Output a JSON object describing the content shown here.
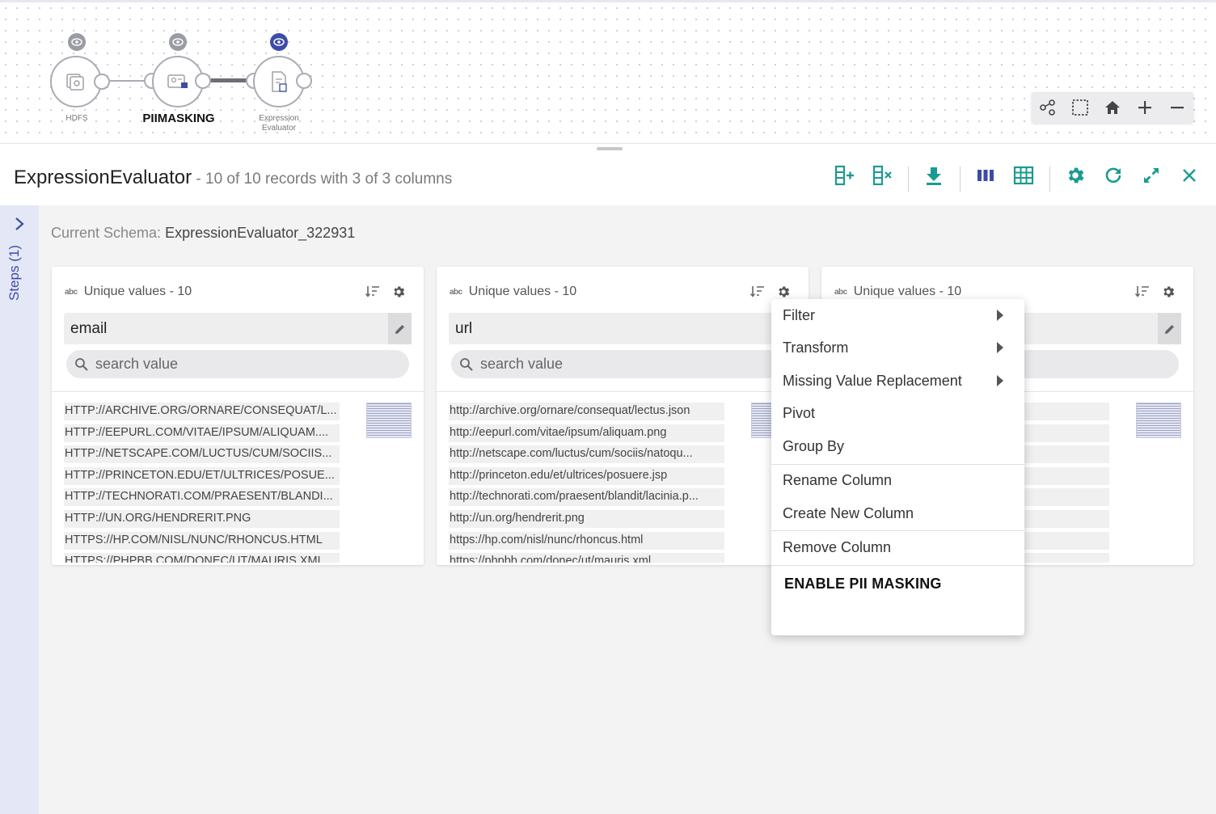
{
  "pipeline": {
    "nodes": [
      {
        "label": "HDFS"
      },
      {
        "label": "PIIMASKING"
      },
      {
        "label": "Expression Evaluator"
      }
    ],
    "tools": [
      "graph-icon",
      "select-icon",
      "home-icon",
      "zoom-in-icon",
      "zoom-out-icon"
    ]
  },
  "header": {
    "title": "ExpressionEvaluator",
    "subtitle": " - 10 of 10 records with 3 of 3 columns",
    "toolbar": [
      "add-column-icon",
      "remove-column-icon",
      "download-icon",
      "column-view-icon",
      "table-view-icon",
      "settings-icon",
      "refresh-icon",
      "expand-icon",
      "close-icon"
    ]
  },
  "steps": {
    "label": "Steps (1)"
  },
  "schema": {
    "label": "Current Schema: ",
    "name": "ExpressionEvaluator_322931"
  },
  "columns": [
    {
      "unique_label": "Unique values - 10",
      "name": "email",
      "search_placeholder": "search value",
      "values": [
        "HTTP://ARCHIVE.ORG/ORNARE/CONSEQUAT/L...",
        "HTTP://EEPURL.COM/VITAE/IPSUM/ALIQUAM....",
        "HTTP://NETSCAPE.COM/LUCTUS/CUM/SOCIIS...",
        "HTTP://PRINCETON.EDU/ET/ULTRICES/POSUE...",
        "HTTP://TECHNORATI.COM/PRAESENT/BLANDI...",
        "HTTP://UN.ORG/HENDRERIT.PNG",
        "HTTPS://HP.COM/NISL/NUNC/RHONCUS.HTML",
        "HTTPS://PHPBB.COM/DONEC/UT/MAURIS.XML"
      ]
    },
    {
      "unique_label": "Unique values - 10",
      "name": "url",
      "search_placeholder": "search value",
      "values": [
        "http://archive.org/ornare/consequat/lectus.json",
        "http://eepurl.com/vitae/ipsum/aliquam.png",
        "http://netscape.com/luctus/cum/sociis/natoqu...",
        "http://princeton.edu/et/ultrices/posuere.jsp",
        "http://technorati.com/praesent/blandit/lacinia.p...",
        "http://un.org/hendrerit.png",
        "https://hp.com/nisl/nunc/rhoncus.html",
        "https://phpbb.com/donec/ut/mauris.xml"
      ]
    },
    {
      "unique_label": "Unique values - 10",
      "name": "",
      "search_placeholder": "",
      "values": [
        "",
        "",
        "",
        "",
        "",
        "",
        "",
        ""
      ]
    }
  ],
  "context_menu": {
    "filter": "Filter",
    "transform": "Transform",
    "missing": "Missing Value Replacement",
    "pivot": "Pivot",
    "group_by": "Group By",
    "rename": "Rename Column",
    "create": "Create New Column",
    "remove": "Remove Column",
    "pii": "ENABLE PII MASKING"
  },
  "colors": {
    "accent": "#1a9b91",
    "primary": "#3d4ba8",
    "rail": "#e4e7f5"
  }
}
